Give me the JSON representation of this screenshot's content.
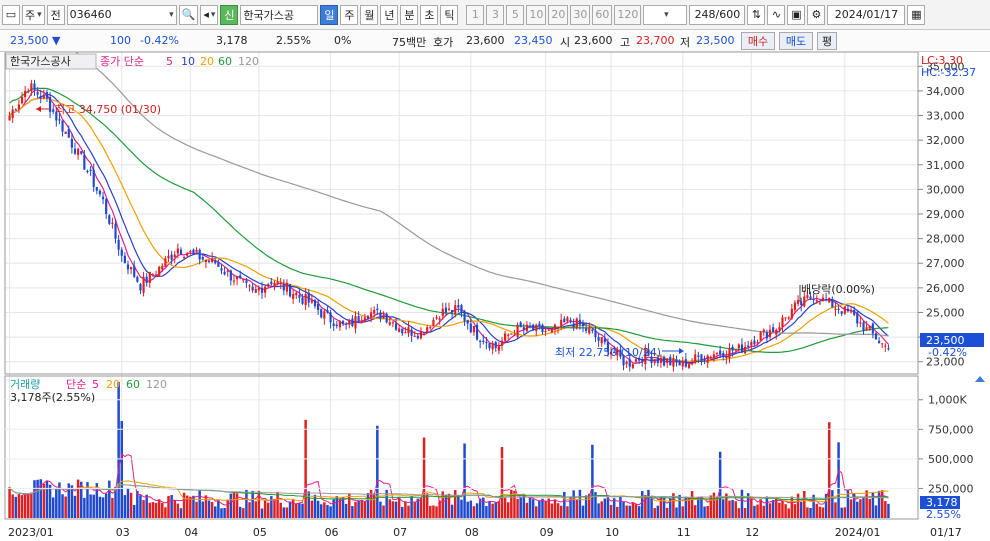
{
  "toolbar": {
    "period_label": "주",
    "prev_label": "전",
    "stock_code": "036460",
    "credit_badge": "신",
    "stock_name": "한국가스공",
    "periods": [
      "일",
      "주",
      "월",
      "년",
      "분",
      "초",
      "틱"
    ],
    "active_period": "일",
    "minute_units": [
      "1",
      "3",
      "5",
      "10",
      "20",
      "30",
      "60",
      "120"
    ],
    "page_count": "248/600",
    "date": "2024/01/17",
    "icons": [
      "search-icon",
      "speaker-icon",
      "chart-icon",
      "line-draw-icon",
      "save-icon",
      "gear-icon",
      "calendar-icon"
    ]
  },
  "info": {
    "price": "23,500",
    "change_arrow": "▼",
    "change": "100",
    "change_pct": "-0.42%",
    "volume": "3,178",
    "volume_ratio": "2.55%",
    "zero_pct": "0%",
    "amount": "75백만",
    "quote_label": "호가",
    "ask": "23,600",
    "bid": "23,450",
    "open_label": "시",
    "open": "23,600",
    "high_label": "고",
    "high": "23,700",
    "low_label": "저",
    "low": "23,500",
    "buy_label": "매수",
    "sell_label": "매도",
    "flat_label": "평"
  },
  "price_panel": {
    "title": "한국가스공사",
    "ma_label": "종가 단순",
    "ma_periods": [
      "5",
      "10",
      "20",
      "60",
      "120"
    ],
    "ma_colors": [
      "#e0208a",
      "#2a3fc8",
      "#f0a000",
      "#1f9a3a",
      "#999999"
    ],
    "lc": "LC:3.30",
    "hc": "HC:-32.37",
    "high_annotation": "최고 34,750 (01/30)",
    "low_annotation": "최저 22,750 (10/24)",
    "dividend_annotation": "배당락(0.00%)",
    "current_price_tag": "23,500",
    "current_change_tag": "-0.42%",
    "y_ticks": [
      "35,000",
      "34,000",
      "33,000",
      "32,000",
      "31,000",
      "30,000",
      "29,000",
      "28,000",
      "27,000",
      "26,000",
      "25,000",
      "24,000",
      "23,000"
    ]
  },
  "volume_panel": {
    "title": "거래량",
    "ma_label": "단순",
    "ma_periods": [
      "5",
      "20",
      "60",
      "120"
    ],
    "ma_colors": [
      "#e0208a",
      "#f0a000",
      "#1f9a3a",
      "#999999"
    ],
    "current_volume_text": "3,178주(2.55%)",
    "current_volume_tag": "3,178",
    "current_pct_tag": "2.55%",
    "y_ticks": [
      "1,000K",
      "750,000",
      "500,000",
      "250,000"
    ]
  },
  "x_axis": {
    "labels": [
      "2023/01",
      "03",
      "04",
      "05",
      "06",
      "07",
      "08",
      "09",
      "10",
      "11",
      "12",
      "2024/01"
    ],
    "right_label": "01/17"
  },
  "chart_data": {
    "type": "candlestick",
    "y_price_range": [
      22500,
      35500
    ],
    "y_volume_range": [
      0,
      1150000
    ],
    "anchors_price": [
      [
        0,
        33000
      ],
      [
        6,
        34200
      ],
      [
        12,
        33600
      ],
      [
        18,
        32300
      ],
      [
        24,
        31000
      ],
      [
        30,
        29500
      ],
      [
        36,
        27300
      ],
      [
        42,
        26100
      ],
      [
        48,
        26800
      ],
      [
        54,
        27600
      ],
      [
        60,
        27300
      ],
      [
        66,
        27000
      ],
      [
        72,
        26400
      ],
      [
        78,
        25800
      ],
      [
        84,
        26300
      ],
      [
        90,
        25900
      ],
      [
        96,
        25400
      ],
      [
        102,
        24800
      ],
      [
        108,
        24400
      ],
      [
        114,
        25000
      ],
      [
        120,
        24900
      ],
      [
        126,
        24300
      ],
      [
        132,
        24200
      ],
      [
        138,
        25000
      ],
      [
        144,
        25100
      ],
      [
        150,
        24100
      ],
      [
        156,
        23600
      ],
      [
        162,
        24300
      ],
      [
        168,
        24300
      ],
      [
        174,
        24200
      ],
      [
        180,
        24700
      ],
      [
        186,
        24200
      ],
      [
        192,
        23600
      ],
      [
        198,
        22900
      ],
      [
        204,
        23300
      ],
      [
        210,
        23000
      ],
      [
        216,
        22900
      ],
      [
        222,
        23200
      ],
      [
        228,
        23400
      ],
      [
        234,
        23500
      ],
      [
        240,
        24000
      ],
      [
        246,
        24400
      ],
      [
        252,
        25200
      ],
      [
        258,
        25700
      ],
      [
        264,
        25300
      ],
      [
        270,
        24900
      ],
      [
        276,
        24200
      ],
      [
        282,
        23500
      ]
    ],
    "current_price": 23500,
    "high": {
      "price": 34750,
      "date": "01/30"
    },
    "low": {
      "price": 22750,
      "date": "10/24"
    },
    "volume_spikes": [
      [
        35,
        1150000
      ],
      [
        36,
        820000
      ],
      [
        95,
        830000
      ],
      [
        118,
        780000
      ],
      [
        133,
        680000
      ],
      [
        146,
        630000
      ],
      [
        158,
        600000
      ],
      [
        187,
        620000
      ],
      [
        228,
        560000
      ],
      [
        263,
        810000
      ],
      [
        266,
        640000
      ]
    ]
  }
}
